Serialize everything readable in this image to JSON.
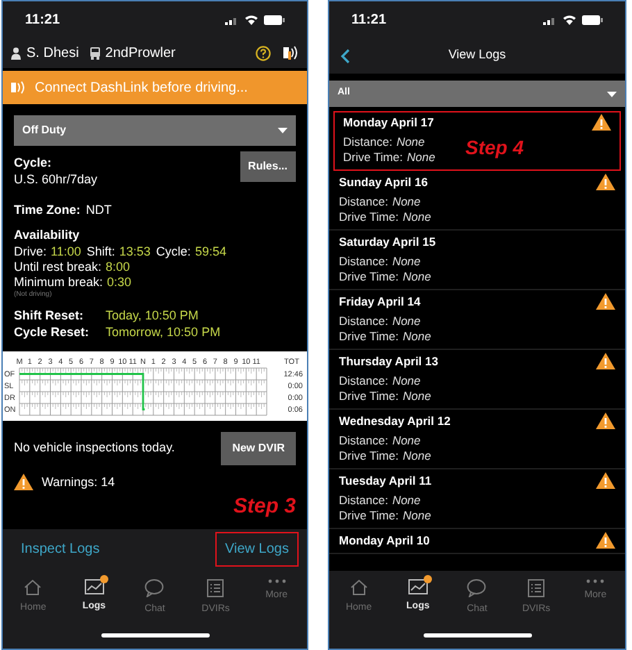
{
  "left_screen": {
    "status_bar": {
      "time": "11:21"
    },
    "header": {
      "driver": "S. Dhesi",
      "vehicle": "2ndProwler"
    },
    "banner": {
      "text": "Connect DashLink before driving..."
    },
    "duty_status": {
      "value": "Off Duty"
    },
    "cycle": {
      "label": "Cycle:",
      "value": "U.S. 60hr/7day"
    },
    "rules_button": "Rules...",
    "time_zone": {
      "label": "Time Zone:",
      "value": "NDT"
    },
    "availability": {
      "title": "Availability",
      "lines": [
        [
          {
            "label": "Drive:",
            "value": "11:00"
          },
          {
            "label": "Shift:",
            "value": "13:53"
          },
          {
            "label": "Cycle:",
            "value": "59:54"
          }
        ],
        [
          {
            "label": "Until rest break:",
            "value": "8:00"
          }
        ],
        [
          {
            "label": "Minimum break:",
            "value": "0:30"
          }
        ]
      ],
      "note": "(Not driving)"
    },
    "resets": [
      {
        "label": "Shift Reset:",
        "value": "Today, 10:50 PM"
      },
      {
        "label": "Cycle Reset:",
        "value": "Tomorrow, 10:50 PM"
      }
    ],
    "log_grid": {
      "hours": [
        "M",
        "1",
        "2",
        "3",
        "4",
        "5",
        "6",
        "7",
        "8",
        "9",
        "10",
        "11",
        "N",
        "1",
        "2",
        "3",
        "4",
        "5",
        "6",
        "7",
        "8",
        "9",
        "10",
        "11"
      ],
      "total_header": "TOT",
      "rows": [
        {
          "label": "OF",
          "total": "12:46"
        },
        {
          "label": "SL",
          "total": "0:00"
        },
        {
          "label": "DR",
          "total": "0:00"
        },
        {
          "label": "ON",
          "total": "0:06"
        }
      ]
    },
    "inspections": {
      "text": "No vehicle inspections today.",
      "button": "New DVIR"
    },
    "warnings": {
      "text": "Warnings: 14"
    },
    "annotation": {
      "text": "Step 3"
    },
    "actions": [
      {
        "label": "Inspect Logs",
        "highlighted": false
      },
      {
        "label": "View Logs",
        "highlighted": true
      }
    ],
    "tabs": [
      {
        "label": "Home",
        "kind": "home",
        "selected": false,
        "badge": false
      },
      {
        "label": "Logs",
        "kind": "logs",
        "selected": true,
        "badge": true
      },
      {
        "label": "Chat",
        "kind": "chat",
        "selected": false,
        "badge": false
      },
      {
        "label": "DVIRs",
        "kind": "list",
        "selected": false,
        "badge": false
      },
      {
        "label": "More",
        "kind": "more",
        "selected": false,
        "badge": false
      }
    ]
  },
  "right_screen": {
    "status_bar": {
      "time": "11:21"
    },
    "nav": {
      "title": "View Logs"
    },
    "filter": {
      "value": "All"
    },
    "annotation": {
      "text": "Step 4"
    },
    "logs": [
      {
        "day": "Monday April 17",
        "distance_label": "Distance:",
        "distance": "None",
        "drive_label": "Drive Time:",
        "drive": "None",
        "warning": true,
        "highlighted": true
      },
      {
        "day": "Sunday April 16",
        "distance_label": "Distance:",
        "distance": "None",
        "drive_label": "Drive Time:",
        "drive": "None",
        "warning": true,
        "highlighted": false
      },
      {
        "day": "Saturday April 15",
        "distance_label": "Distance:",
        "distance": "None",
        "drive_label": "Drive Time:",
        "drive": "None",
        "warning": false,
        "highlighted": false
      },
      {
        "day": "Friday April 14",
        "distance_label": "Distance:",
        "distance": "None",
        "drive_label": "Drive Time:",
        "drive": "None",
        "warning": true,
        "highlighted": false
      },
      {
        "day": "Thursday April 13",
        "distance_label": "Distance:",
        "distance": "None",
        "drive_label": "Drive Time:",
        "drive": "None",
        "warning": true,
        "highlighted": false
      },
      {
        "day": "Wednesday April 12",
        "distance_label": "Distance:",
        "distance": "None",
        "drive_label": "Drive Time:",
        "drive": "None",
        "warning": true,
        "highlighted": false
      },
      {
        "day": "Tuesday April 11",
        "distance_label": "Distance:",
        "distance": "None",
        "drive_label": "Drive Time:",
        "drive": "None",
        "warning": true,
        "highlighted": false
      },
      {
        "day": "Monday April 10",
        "warning": true,
        "highlighted": false
      }
    ],
    "tabs": [
      {
        "label": "Home",
        "kind": "home",
        "selected": false,
        "badge": false
      },
      {
        "label": "Logs",
        "kind": "logs",
        "selected": true,
        "badge": true
      },
      {
        "label": "Chat",
        "kind": "chat",
        "selected": false,
        "badge": false
      },
      {
        "label": "DVIRs",
        "kind": "list",
        "selected": false,
        "badge": false
      },
      {
        "label": "More",
        "kind": "more",
        "selected": false,
        "badge": false
      }
    ]
  }
}
